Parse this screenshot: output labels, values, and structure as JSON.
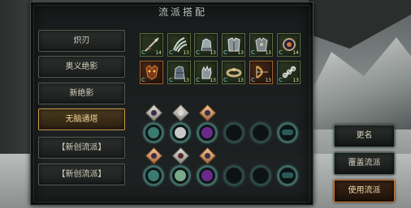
{
  "title": "流派搭配",
  "schools": [
    {
      "label": "炽刃",
      "active": false
    },
    {
      "label": "奥义绝影",
      "active": false
    },
    {
      "label": "新绝影",
      "active": false
    },
    {
      "label": "无脑通塔",
      "active": true
    },
    {
      "label": "【新创流派】",
      "active": false
    },
    {
      "label": "【新创流派】",
      "active": false
    }
  ],
  "equipment_rows": [
    [
      {
        "icon": "spear-icon",
        "level": "14",
        "frame": "green"
      },
      {
        "icon": "claw-icon",
        "level": "13",
        "frame": "green"
      },
      {
        "icon": "gauntlet-icon",
        "level": "13",
        "frame": "green"
      },
      {
        "icon": "armor-icon",
        "level": "13",
        "frame": "green"
      },
      {
        "icon": "armor-icon",
        "level": "13",
        "frame": "green"
      },
      {
        "icon": "orb-icon",
        "level": "14",
        "frame": "green"
      }
    ],
    [
      {
        "icon": "beast-mask-icon",
        "level": "",
        "frame": "orange"
      },
      {
        "icon": "gauntlet-icon",
        "level": "13",
        "frame": "green"
      },
      {
        "icon": "hand-icon",
        "level": "13",
        "frame": "green"
      },
      {
        "icon": "ring-icon",
        "level": "13",
        "frame": "green"
      },
      {
        "icon": "bow-icon",
        "level": "13",
        "frame": "orange"
      },
      {
        "icon": "chain-icon",
        "level": "13",
        "frame": "green"
      }
    ]
  ],
  "buttons": {
    "rename": "更名",
    "overwrite": "覆盖流派",
    "use": "使用流派"
  },
  "colors": {
    "active_border": "#c79a45",
    "primary_border": "#c9742e",
    "slot_green": "#5c6a3d",
    "socket_teal": "#3e6a66"
  }
}
